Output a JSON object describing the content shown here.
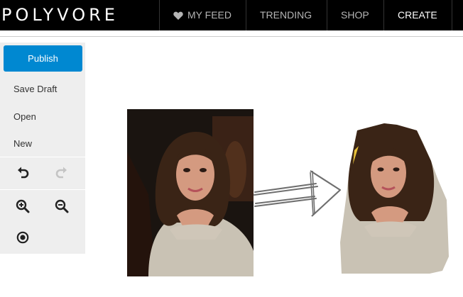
{
  "header": {
    "logo": "POLYVORE",
    "nav": [
      {
        "label": "MY FEED",
        "icon": "heart-icon"
      },
      {
        "label": "TRENDING"
      },
      {
        "label": "SHOP"
      },
      {
        "label": "CREATE",
        "active": true
      }
    ]
  },
  "sidebar": {
    "publish_label": "Publish",
    "items": [
      "Save Draft",
      "Open",
      "New"
    ],
    "tools": [
      "undo-icon",
      "redo-icon",
      "zoom-in-icon",
      "zoom-out-icon",
      "target-icon"
    ]
  },
  "colors": {
    "topbar": "#000000",
    "publish": "#0088d1",
    "sidebar": "#eeeeee"
  }
}
